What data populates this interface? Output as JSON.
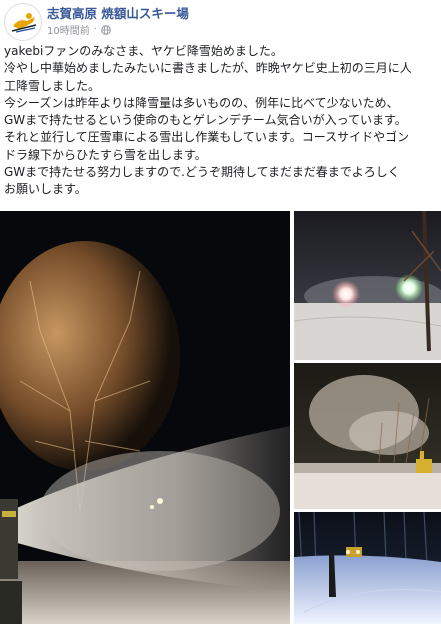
{
  "page": {
    "name": "志賀高原 焼額山スキー場",
    "timestamp": "10時間前",
    "privacy_icon": "globe-icon",
    "avatar_icon": "skier-logo-icon"
  },
  "post": {
    "lines": [
      "yakebiファンのみなさま、ヤケビ降雪始めました。",
      "冷やし中華始めましたみたいに書きましたが、昨晩ヤケビ史上初の三月に人",
      "工降雪しました。",
      "今シーズンは昨年よりは降雪量は多いものの、例年に比べて少ないため、",
      "GWまで持たせるという使命のもとゲレンデチーム気合いが入っています。",
      "それと並行して圧雪車による雪出し作業もしています。コースサイドやゴン",
      "ドラ線下からひたすら雪を出します。",
      "GWまで持たせる努力しますので.どうぞ期待してまだまだ春までよろしく",
      "お願いします。"
    ]
  },
  "photos": [
    {
      "subject": "snow-cannon-night-trees"
    },
    {
      "subject": "snowmaking-lights-slope"
    },
    {
      "subject": "snow-gun-plume-dusk"
    },
    {
      "subject": "groomer-on-snowy-trail"
    }
  ]
}
